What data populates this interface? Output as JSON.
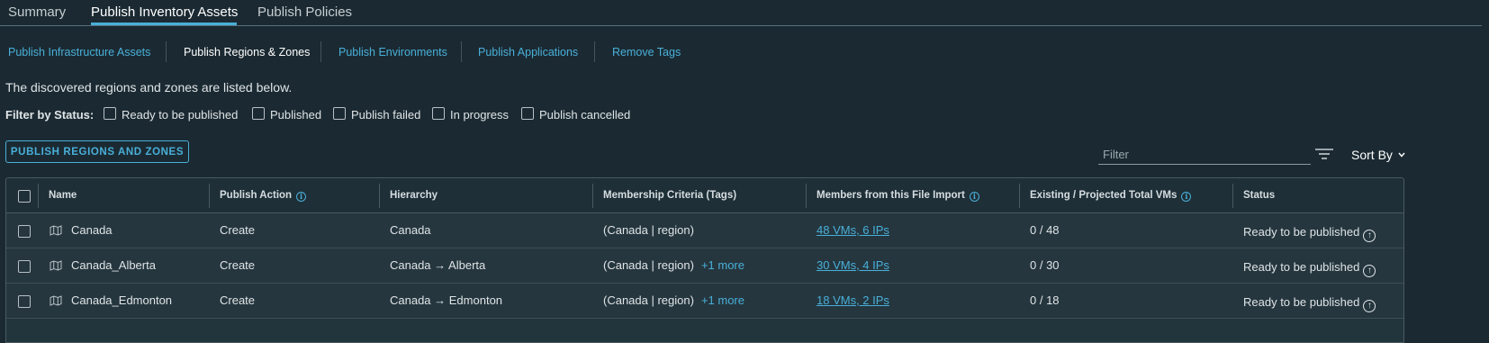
{
  "tabs": [
    "Summary",
    "Publish Inventory Assets",
    "Publish Policies"
  ],
  "subtabs": [
    "Publish Infrastructure Assets",
    "Publish Regions & Zones",
    "Publish Environments",
    "Publish Applications",
    "Remove Tags"
  ],
  "description": "The discovered regions and zones are listed below.",
  "filter": {
    "label": "Filter by Status:",
    "options": [
      "Ready to be published",
      "Published",
      "Publish failed",
      "In progress",
      "Publish cancelled"
    ]
  },
  "actions": {
    "publish_button": "PUBLISH REGIONS AND ZONES",
    "filter_placeholder": "Filter",
    "sort_label": "Sort By"
  },
  "table": {
    "columns": [
      "Name",
      "Publish Action",
      "Hierarchy",
      "Membership Criteria (Tags)",
      "Members from this File Import",
      "Existing / Projected Total VMs",
      "Status"
    ],
    "rows": [
      {
        "name": "Canada",
        "action": "Create",
        "hierarchy": "Canada",
        "criteria": "(Canada | region)",
        "more": "",
        "members": "48 VMs, 6 IPs",
        "totals": "0 / 48",
        "status": "Ready to be published"
      },
      {
        "name": "Canada_Alberta",
        "action": "Create",
        "hierarchy": "Canada → Alberta",
        "criteria": "(Canada | region)",
        "more": "+1 more",
        "members": "30 VMs, 4 IPs",
        "totals": "0 / 30",
        "status": "Ready to be published"
      },
      {
        "name": "Canada_Edmonton",
        "action": "Create",
        "hierarchy": "Canada → Edmonton",
        "criteria": "(Canada | region)",
        "more": "+1 more",
        "members": "18 VMs, 2 IPs",
        "totals": "0 / 18",
        "status": "Ready to be published"
      }
    ]
  },
  "colors": {
    "accent": "#49afd9",
    "background": "#1b2a32"
  },
  "icons": {
    "row": "map-icon",
    "status": "arrow-up-circle-icon",
    "filter": "filter-lines-icon",
    "info": "info-icon",
    "sort": "chevron-down-icon"
  }
}
